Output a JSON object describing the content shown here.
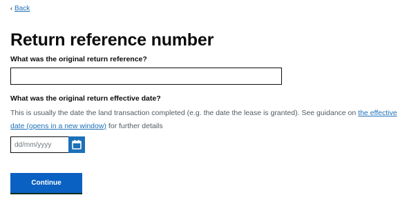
{
  "back": {
    "icon": "chevron-left-icon",
    "label": "Back"
  },
  "page": {
    "title": "Return reference number"
  },
  "reference": {
    "label": "What was the original return reference?",
    "value": "",
    "placeholder": ""
  },
  "effective_date": {
    "label": "What was the original return effective date?",
    "hint_before": "This is usually the date the land transaction completed (e.g. the date the lease is granted). See guidance on ",
    "hint_link": "the effective date (opens in a new window)",
    "hint_after": " for further details",
    "placeholder": "dd/mm/yyyy",
    "value": "",
    "calendar_icon": "calendar-icon"
  },
  "actions": {
    "continue_label": "Continue"
  },
  "colors": {
    "link": "#1d70b8",
    "primary_button": "#0b61c1",
    "text": "#0b0c0c",
    "hint_text": "#505a5f"
  }
}
